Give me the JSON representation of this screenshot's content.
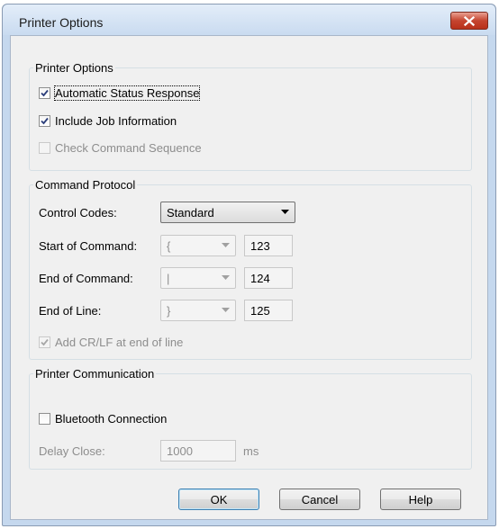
{
  "window": {
    "title": "Printer Options"
  },
  "group_printer_options": {
    "legend": "Printer Options",
    "auto_status_label": "Automatic Status Response",
    "auto_status_checked": true,
    "include_job_label": "Include Job Information",
    "include_job_checked": true,
    "check_sequence_label": "Check Command Sequence",
    "check_sequence_checked": false
  },
  "group_command_protocol": {
    "legend": "Command Protocol",
    "control_codes_label": "Control Codes:",
    "control_codes_value": "Standard",
    "start_label": "Start of Command:",
    "start_char": "{",
    "start_code": "123",
    "end_label": "End of Command:",
    "end_char": "|",
    "end_code": "124",
    "eol_label": "End of Line:",
    "eol_char": "}",
    "eol_code": "125",
    "crlf_label": "Add CR/LF at end of line",
    "crlf_checked": true
  },
  "group_communication": {
    "legend": "Printer Communication",
    "bluetooth_label": "Bluetooth Connection",
    "bluetooth_checked": false,
    "delay_label": "Delay Close:",
    "delay_value": "1000",
    "delay_unit": "ms"
  },
  "buttons": {
    "ok": "OK",
    "cancel": "Cancel",
    "help": "Help"
  },
  "colors": {
    "close_button": "#c5442f",
    "disabled_text": "#8d8d8d",
    "frame": "#c5d8ee"
  }
}
